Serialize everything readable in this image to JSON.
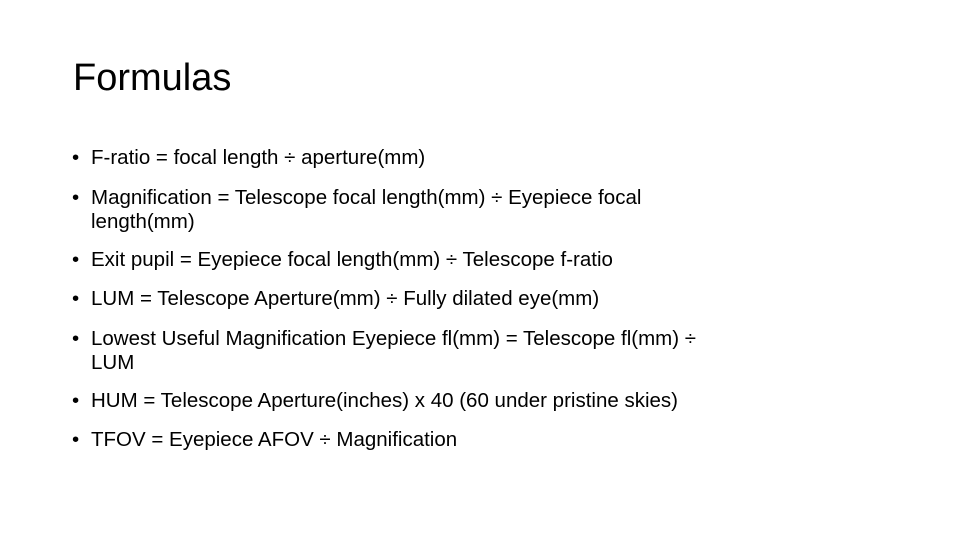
{
  "slide": {
    "title": "Formulas",
    "bullet_glyph": "•",
    "bullets": [
      {
        "line1": "F-ratio = focal length  ÷ aperture(mm)",
        "line2": ""
      },
      {
        "line1": "Magnification = Telescope focal length(mm) ÷ Eyepiece focal",
        "line2": "length(mm)"
      },
      {
        "line1": "Exit pupil = Eyepiece focal length(mm) ÷ Telescope f-ratio",
        "line2": ""
      },
      {
        "line1": "LUM = Telescope Aperture(mm) ÷ Fully dilated eye(mm)",
        "line2": ""
      },
      {
        "line1": "Lowest Useful Magnification Eyepiece fl(mm) = Telescope fl(mm) ÷",
        "line2": "LUM"
      },
      {
        "line1": "HUM = Telescope Aperture(inches) x 40 (60 under pristine skies)",
        "line2": ""
      },
      {
        "line1": "TFOV = Eyepiece AFOV ÷ Magnification",
        "line2": ""
      }
    ]
  }
}
